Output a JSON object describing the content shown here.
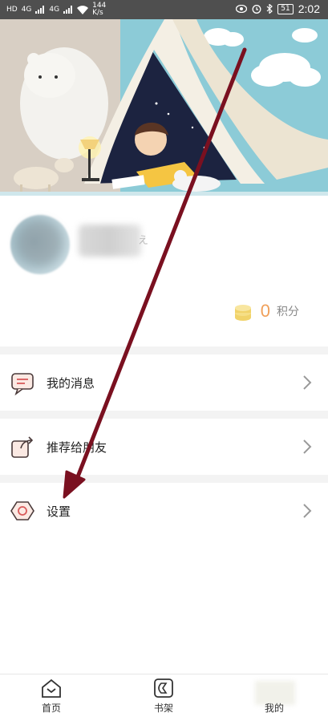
{
  "status_bar": {
    "left_indicators": [
      "HD",
      "4G",
      "4G",
      "144 K/s"
    ],
    "time": "2:02",
    "battery": "51"
  },
  "profile": {
    "username_tail": "え",
    "points_value": "0",
    "points_unit": "积分"
  },
  "menu": {
    "items": [
      {
        "label": "我的消息",
        "icon": "message-icon"
      },
      {
        "label": "推荐给朋友",
        "icon": "share-icon"
      },
      {
        "label": "设置",
        "icon": "settings-icon"
      }
    ]
  },
  "bottom_nav": {
    "items": [
      {
        "label": "首页",
        "icon": "home-icon"
      },
      {
        "label": "书架",
        "icon": "bookshelf-icon"
      },
      {
        "label": "我的",
        "icon": "profile-icon"
      }
    ]
  },
  "colors": {
    "accent": "#f0a05a",
    "annotation_arrow": "#7a1020",
    "status_bar": "#4f4f4f"
  }
}
